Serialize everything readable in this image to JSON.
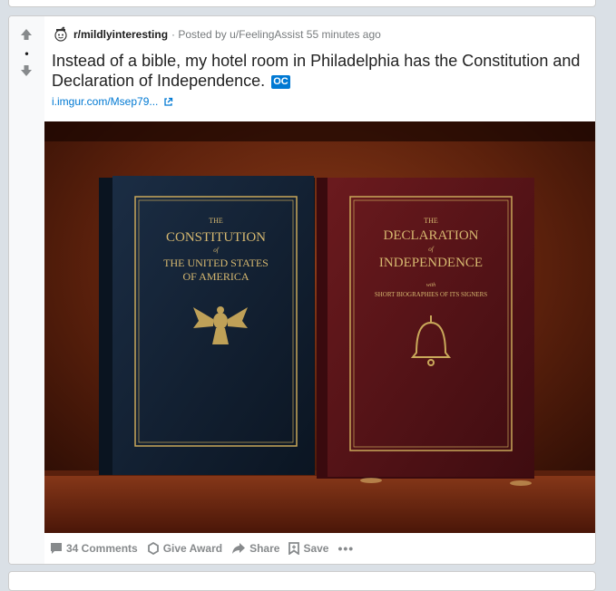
{
  "post": {
    "score": "•",
    "subreddit": "r/mildlyinteresting",
    "posted_by": "· Posted by u/FeelingAssist 55 minutes ago",
    "title": "Instead of a bible, my hotel room in Philadelphia has the Constitution and Declaration of Independence.",
    "flair": "OC",
    "link_text": "i.imgur.com/Msep79...",
    "image": {
      "left_book": {
        "line1": "THE",
        "line2": "CONSTITUTION",
        "line3": "of",
        "line4": "THE UNITED STATES",
        "line5": "OF AMERICA"
      },
      "right_book": {
        "line1": "THE",
        "line2": "DECLARATION",
        "line3": "of",
        "line4": "INDEPENDENCE",
        "line5": "with",
        "line6": "SHORT BIOGRAPHIES OF ITS SIGNERS"
      }
    },
    "actions": {
      "comments": "34 Comments",
      "award": "Give Award",
      "share": "Share",
      "save": "Save",
      "more": "•••"
    }
  },
  "colors": {
    "accent": "#0079d3",
    "upvote_gray": "#878a8c",
    "book_left": "#0f1c2c",
    "book_right": "#5a1418",
    "gold": "#c9a85a"
  }
}
